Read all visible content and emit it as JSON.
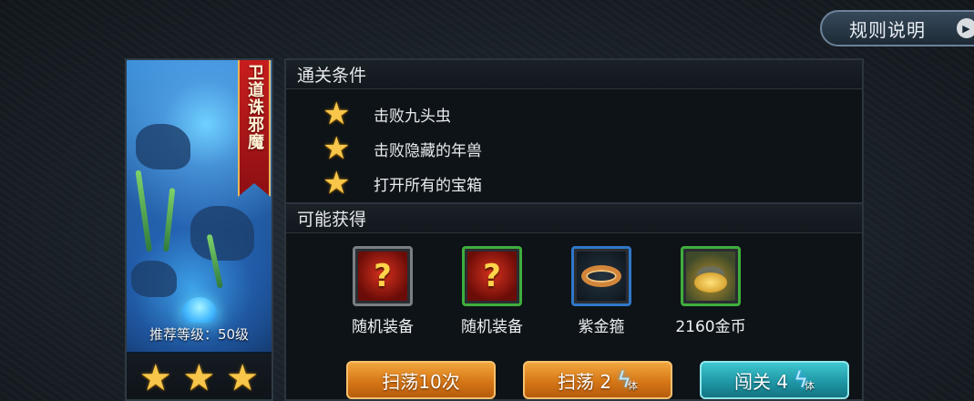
{
  "rules_button": {
    "label": "规则说明"
  },
  "stage": {
    "banner_title": "卫道诛邪魔",
    "recommend_level": "推荐等级：50级",
    "stars_earned": 3
  },
  "conditions": {
    "header": "通关条件",
    "items": [
      {
        "text": "击败九头虫"
      },
      {
        "text": "击败隐藏的年兽"
      },
      {
        "text": "打开所有的宝箱"
      }
    ]
  },
  "rewards": {
    "header": "可能获得",
    "items": [
      {
        "label": "随机装备",
        "icon": "random-equipment-icon",
        "frame": "gray",
        "glyph": "?"
      },
      {
        "label": "随机装备",
        "icon": "random-equipment-icon",
        "frame": "green",
        "glyph": "?"
      },
      {
        "label": "紫金箍",
        "icon": "golden-ring-icon",
        "frame": "blue"
      },
      {
        "label": "2160金币",
        "icon": "gold-coins-icon",
        "frame": "green"
      }
    ]
  },
  "buttons": {
    "sweep10": {
      "label": "扫荡10次"
    },
    "sweep": {
      "label": "扫荡 2",
      "stamina_unit": "体"
    },
    "challenge": {
      "label": "闯关 4",
      "stamina_unit": "体"
    }
  },
  "colors": {
    "star": "#f7c64a",
    "orange_button": "#d67717",
    "teal_button": "#1f97a6",
    "green_frame": "#3fae3c",
    "blue_frame": "#2f78c8"
  }
}
